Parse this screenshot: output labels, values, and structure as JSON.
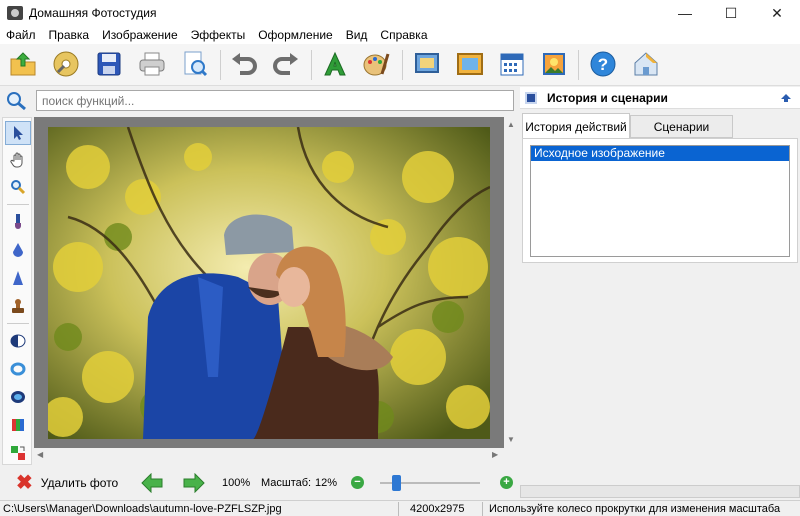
{
  "window": {
    "title": "Домашняя Фотостудия",
    "controls": {
      "minimize": "—",
      "maximize": "☐",
      "close": "✕"
    }
  },
  "menu": [
    "Файл",
    "Правка",
    "Изображение",
    "Эффекты",
    "Оформление",
    "Вид",
    "Справка"
  ],
  "toolbar": {
    "icons": [
      "open-folder-icon",
      "photo-disc-icon",
      "save-icon",
      "print-icon",
      "document-search-icon",
      "undo-icon",
      "redo-icon",
      "text-icon",
      "palette-icon",
      "frame-icon",
      "picture-frame-icon",
      "calendar-icon",
      "postcard-icon",
      "help-icon",
      "home-icon"
    ]
  },
  "search": {
    "placeholder": "поиск функций..."
  },
  "left_tools": [
    "cursor-icon",
    "hand-icon",
    "zoom-icon",
    "brush-icon",
    "drop-icon",
    "sharpen-icon",
    "stamp-icon",
    "contrast-icon",
    "ring-icon",
    "lens-icon",
    "color-levels-icon",
    "color-replace-icon"
  ],
  "panel": {
    "title": "История и сценарии",
    "tabs": [
      "История действий",
      "Сценарии"
    ],
    "active_tab": "История действий",
    "history": [
      "Исходное изображение"
    ],
    "selected_history": "Исходное изображение"
  },
  "bottom": {
    "delete_label": "Удалить фото",
    "zoom_percent": "100%",
    "scale_label": "Масштаб:",
    "scale_value": "12%",
    "slider_level_percent": 16
  },
  "status": {
    "path": "C:\\Users\\Manager\\Downloads\\autumn-love-PZFLSZP.jpg",
    "dimensions": "4200x2975",
    "hint": "Используйте колесо прокрутки для изменения масштаба"
  },
  "colors": {
    "selection": "#0a64d2",
    "accent_green": "#3aa843",
    "delete_red": "#d9342b"
  }
}
